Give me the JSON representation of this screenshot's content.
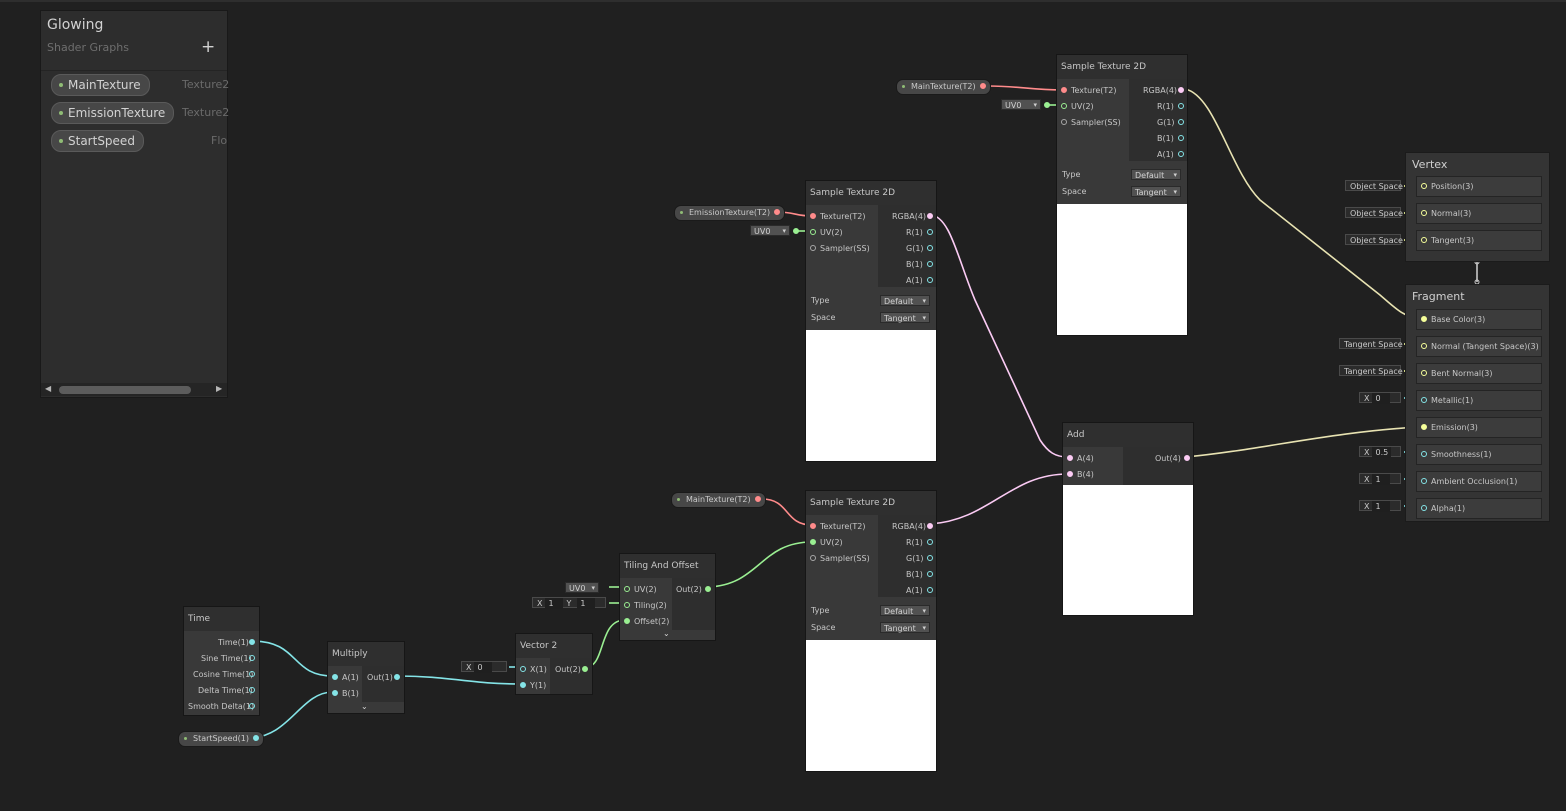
{
  "blackboard": {
    "title": "Glowing",
    "subtitle": "Shader Graphs",
    "add_label": "+",
    "properties": [
      {
        "name": "MainTexture",
        "type": "Texture2"
      },
      {
        "name": "EmissionTexture",
        "type": "Texture2"
      },
      {
        "name": "StartSpeed",
        "type": "Flo"
      }
    ]
  },
  "nodes": {
    "sample_top": {
      "title": "Sample Texture 2D",
      "inputs": [
        "Texture(T2)",
        "UV(2)",
        "Sampler(SS)"
      ],
      "outputs": [
        "RGBA(4)",
        "R(1)",
        "G(1)",
        "B(1)",
        "A(1)"
      ],
      "type_label": "Type",
      "type_value": "Default",
      "space_label": "Space",
      "space_value": "Tangent",
      "uv_value": "UV0"
    },
    "sample_mid": {
      "title": "Sample Texture 2D",
      "inputs": [
        "Texture(T2)",
        "UV(2)",
        "Sampler(SS)"
      ],
      "outputs": [
        "RGBA(4)",
        "R(1)",
        "G(1)",
        "B(1)",
        "A(1)"
      ],
      "type_label": "Type",
      "type_value": "Default",
      "space_label": "Space",
      "space_value": "Tangent",
      "uv_value": "UV0"
    },
    "sample_bot": {
      "title": "Sample Texture 2D",
      "inputs": [
        "Texture(T2)",
        "UV(2)",
        "Sampler(SS)"
      ],
      "outputs": [
        "RGBA(4)",
        "R(1)",
        "G(1)",
        "B(1)",
        "A(1)"
      ],
      "type_label": "Type",
      "type_value": "Default",
      "space_label": "Space",
      "space_value": "Tangent"
    },
    "add": {
      "title": "Add",
      "inputs": [
        "A(4)",
        "B(4)"
      ],
      "output": "Out(4)"
    },
    "time": {
      "title": "Time",
      "outputs": [
        "Time(1)",
        "Sine Time(1)",
        "Cosine Time(1)",
        "Delta Time(1)",
        "Smooth Delta(1)"
      ]
    },
    "multiply": {
      "title": "Multiply",
      "inputs": [
        "A(1)",
        "B(1)"
      ],
      "output": "Out(1)"
    },
    "vector2": {
      "title": "Vector 2",
      "inputs": [
        "X(1)",
        "Y(1)"
      ],
      "output": "Out(2)",
      "x_label": "X",
      "x_value": "0"
    },
    "tiling": {
      "title": "Tiling And Offset",
      "inputs": [
        "UV(2)",
        "Tiling(2)",
        "Offset(2)"
      ],
      "output": "Out(2)",
      "uv_value": "UV0",
      "tiling_x_label": "X",
      "tiling_x": "1",
      "tiling_y_label": "Y",
      "tiling_y": "1"
    }
  },
  "property_nodes": {
    "main_top": "MainTexture(T2)",
    "emission": "EmissionTexture(T2)",
    "main_bot": "MainTexture(T2)",
    "start_speed": "StartSpeed(1)"
  },
  "master": {
    "vertex": {
      "title": "Vertex",
      "blocks": [
        {
          "label": "Position(3)",
          "input": "Object Space"
        },
        {
          "label": "Normal(3)",
          "input": "Object Space"
        },
        {
          "label": "Tangent(3)",
          "input": "Object Space"
        }
      ]
    },
    "fragment": {
      "title": "Fragment",
      "blocks": [
        {
          "label": "Base Color(3)",
          "input": ""
        },
        {
          "label": "Normal (Tangent Space)(3)",
          "input": "Tangent Space"
        },
        {
          "label": "Bent Normal(3)",
          "input": "Tangent Space"
        },
        {
          "label": "Metallic(1)",
          "input_axis": "X",
          "input_value": "0"
        },
        {
          "label": "Emission(3)",
          "input": ""
        },
        {
          "label": "Smoothness(1)",
          "input_axis": "X",
          "input_value": "0.5"
        },
        {
          "label": "Ambient Occlusion(1)",
          "input_axis": "X",
          "input_value": "1"
        },
        {
          "label": "Alpha(1)",
          "input_axis": "X",
          "input_value": "1"
        }
      ]
    }
  },
  "colors": {
    "texture_wire": "#ff8b8b",
    "vector4_wire": "#fbcbf4",
    "vector3_wire": "#f6ff9a",
    "vector2_wire": "#9aef92",
    "float_wire": "#84e4e7",
    "graph_background": "#202020"
  },
  "icons": {
    "add": "plus-icon",
    "expand": "chevron-down-icon",
    "scroll_left": "arrow-left-icon",
    "scroll_right": "arrow-right-icon"
  }
}
